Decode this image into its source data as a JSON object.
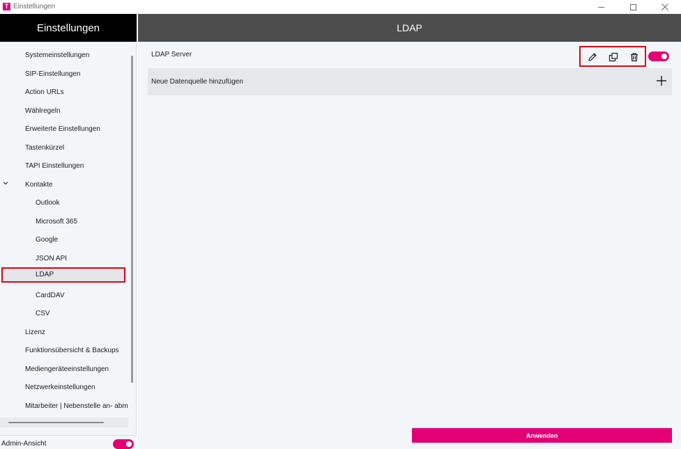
{
  "window": {
    "logo": "T",
    "title": "Einstellungen"
  },
  "sidebar": {
    "header": "Einstellungen",
    "items": [
      {
        "label": "Systemeinstellungen",
        "level": 1
      },
      {
        "label": "SIP-Einstellungen",
        "level": 1
      },
      {
        "label": "Action URLs",
        "level": 1
      },
      {
        "label": "Wählregeln",
        "level": 1
      },
      {
        "label": "Erweiterte Einstellungen",
        "level": 1
      },
      {
        "label": "Tastenkürzel",
        "level": 1
      },
      {
        "label": "TAPI Einstellungen",
        "level": 1
      },
      {
        "label": "Kontakte",
        "level": 1,
        "expanded": true
      },
      {
        "label": "Outlook",
        "level": 2
      },
      {
        "label": "Microsoft 365",
        "level": 2
      },
      {
        "label": "Google",
        "level": 2
      },
      {
        "label": "JSON API",
        "level": 2
      },
      {
        "label": "LDAP",
        "level": 2,
        "selected": true
      },
      {
        "label": "CardDAV",
        "level": 2
      },
      {
        "label": "CSV",
        "level": 2
      },
      {
        "label": "Lizenz",
        "level": 1
      },
      {
        "label": "Funktionsübersicht & Backups",
        "level": 1
      },
      {
        "label": "Mediengeräteeinstellungen",
        "level": 1
      },
      {
        "label": "Netzwerkeinstellungen",
        "level": 1
      },
      {
        "label": "Mitarbeiter | Nebenstelle an- abmelden",
        "level": 1
      }
    ],
    "admin_label": "Admin-Ansicht",
    "admin_enabled": true
  },
  "main": {
    "title": "LDAP",
    "sources": [
      {
        "name": "LDAP Server",
        "enabled": true
      }
    ],
    "add_label": "Neue Datenquelle hinzufügen",
    "apply_label": "Anwenden"
  },
  "colors": {
    "accent": "#e20074",
    "highlight_box": "#e3000f",
    "sidebar_header_bg": "#000000",
    "main_header_bg": "#4d4d4d",
    "panel_bg": "#f3f6f9"
  },
  "icons": {
    "edit": "pencil-icon",
    "copy": "copy-icon",
    "delete": "trash-icon",
    "add": "plus-icon",
    "expand": "chevron-down-icon"
  }
}
